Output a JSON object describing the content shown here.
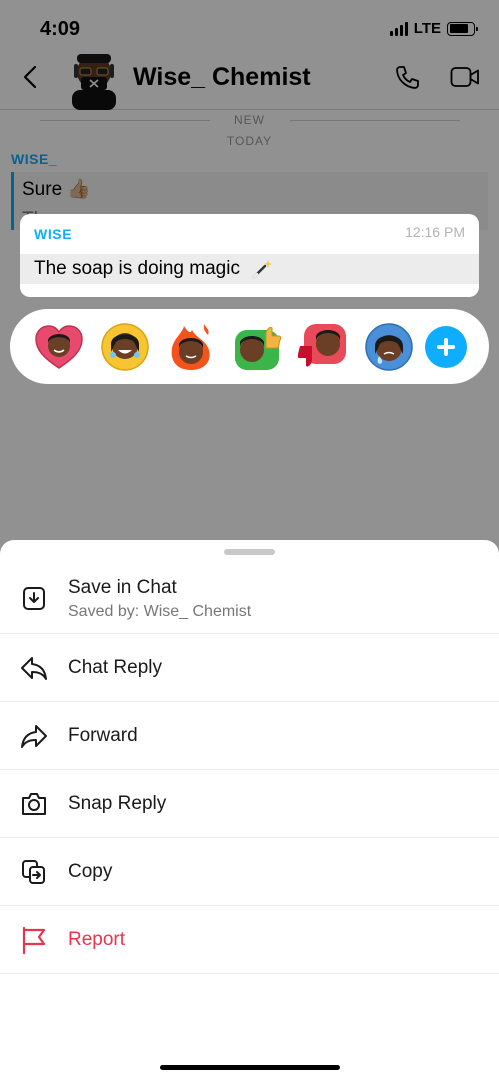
{
  "status": {
    "time": "4:09",
    "network": "LTE"
  },
  "header": {
    "title": "Wise_ Chemist"
  },
  "chat": {
    "new_label": "NEW",
    "today_label": "TODAY",
    "sender": "WISE_",
    "background_message": "Sure 👍🏼",
    "background_message_2": "Th... s... ... ..."
  },
  "selected_message": {
    "sender": "WISE",
    "time": "12:16 PM",
    "text": "The soap is doing magic"
  },
  "reactions": {
    "items": [
      "heart-bitmoji",
      "laughing-bitmoji",
      "fire-bitmoji",
      "thumbs-up-bitmoji",
      "thumbs-down-bitmoji",
      "crying-bitmoji"
    ],
    "add_icon": "plus-icon"
  },
  "sheet": {
    "save": {
      "label": "Save in Chat",
      "sub": "Saved by: Wise_ Chemist",
      "icon": "save-icon"
    },
    "reply": {
      "label": "Chat Reply",
      "icon": "reply-icon"
    },
    "forward": {
      "label": "Forward",
      "icon": "forward-icon"
    },
    "snap_reply": {
      "label": "Snap Reply",
      "icon": "camera-icon"
    },
    "copy": {
      "label": "Copy",
      "icon": "copy-icon"
    },
    "report": {
      "label": "Report",
      "icon": "flag-icon"
    }
  },
  "colors": {
    "accent": "#0eadff",
    "danger": "#e8344f"
  }
}
